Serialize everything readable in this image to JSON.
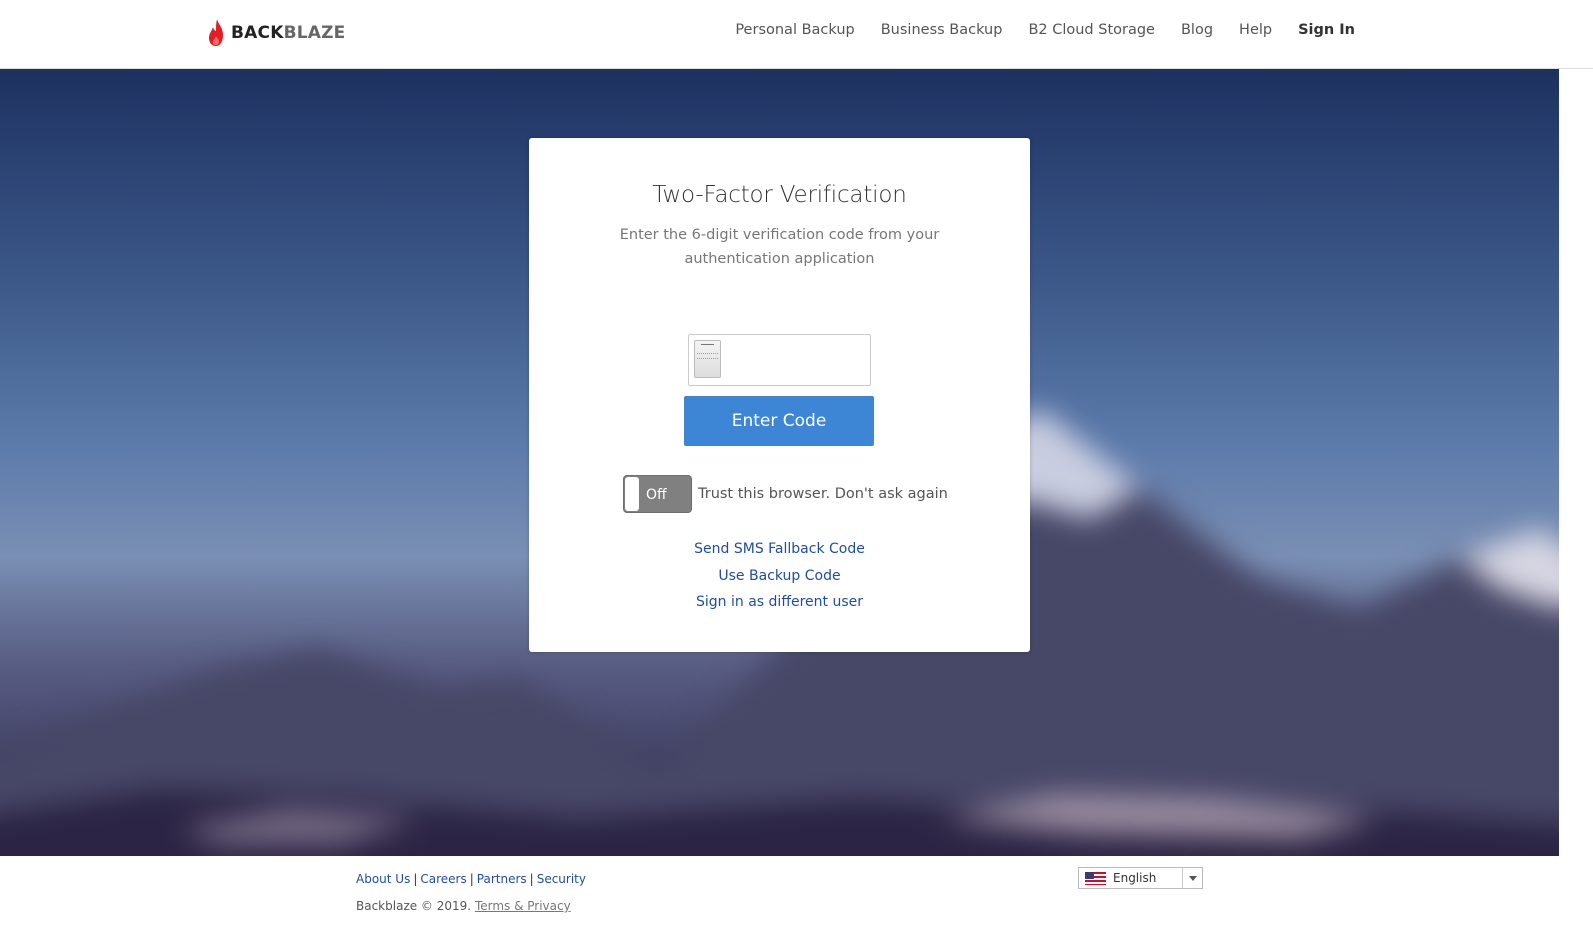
{
  "brand": {
    "name_part1": "BACK",
    "name_part2": "BLAZE",
    "flame_color": "#e21e25"
  },
  "nav": {
    "items": [
      {
        "label": "Personal Backup"
      },
      {
        "label": "Business Backup"
      },
      {
        "label": "B2 Cloud Storage"
      },
      {
        "label": "Blog"
      },
      {
        "label": "Help"
      }
    ],
    "sign_in": "Sign In"
  },
  "card": {
    "title": "Two-Factor Verification",
    "subtitle": "Enter the 6-digit verification code from your authentication application",
    "code_input": {
      "value": "",
      "placeholder": ""
    },
    "submit_label": "Enter Code",
    "trust_toggle": {
      "state": "Off",
      "label": "Trust this browser. Don't ask again"
    },
    "links": [
      {
        "label": "Send SMS Fallback Code"
      },
      {
        "label": "Use Backup Code"
      },
      {
        "label": "Sign in as different user"
      }
    ]
  },
  "footer": {
    "links": [
      {
        "label": "About Us"
      },
      {
        "label": "Careers"
      },
      {
        "label": "Partners"
      },
      {
        "label": "Security"
      }
    ],
    "separator": "|",
    "copyright": "Backblaze © 2019.",
    "terms_label": "Terms & Privacy",
    "language": {
      "selected": "English",
      "flag_icon": "us-flag-icon"
    }
  },
  "colors": {
    "primary_button": "#3d86d6",
    "link": "#1f4e9e",
    "toggle_off": "#808080"
  }
}
